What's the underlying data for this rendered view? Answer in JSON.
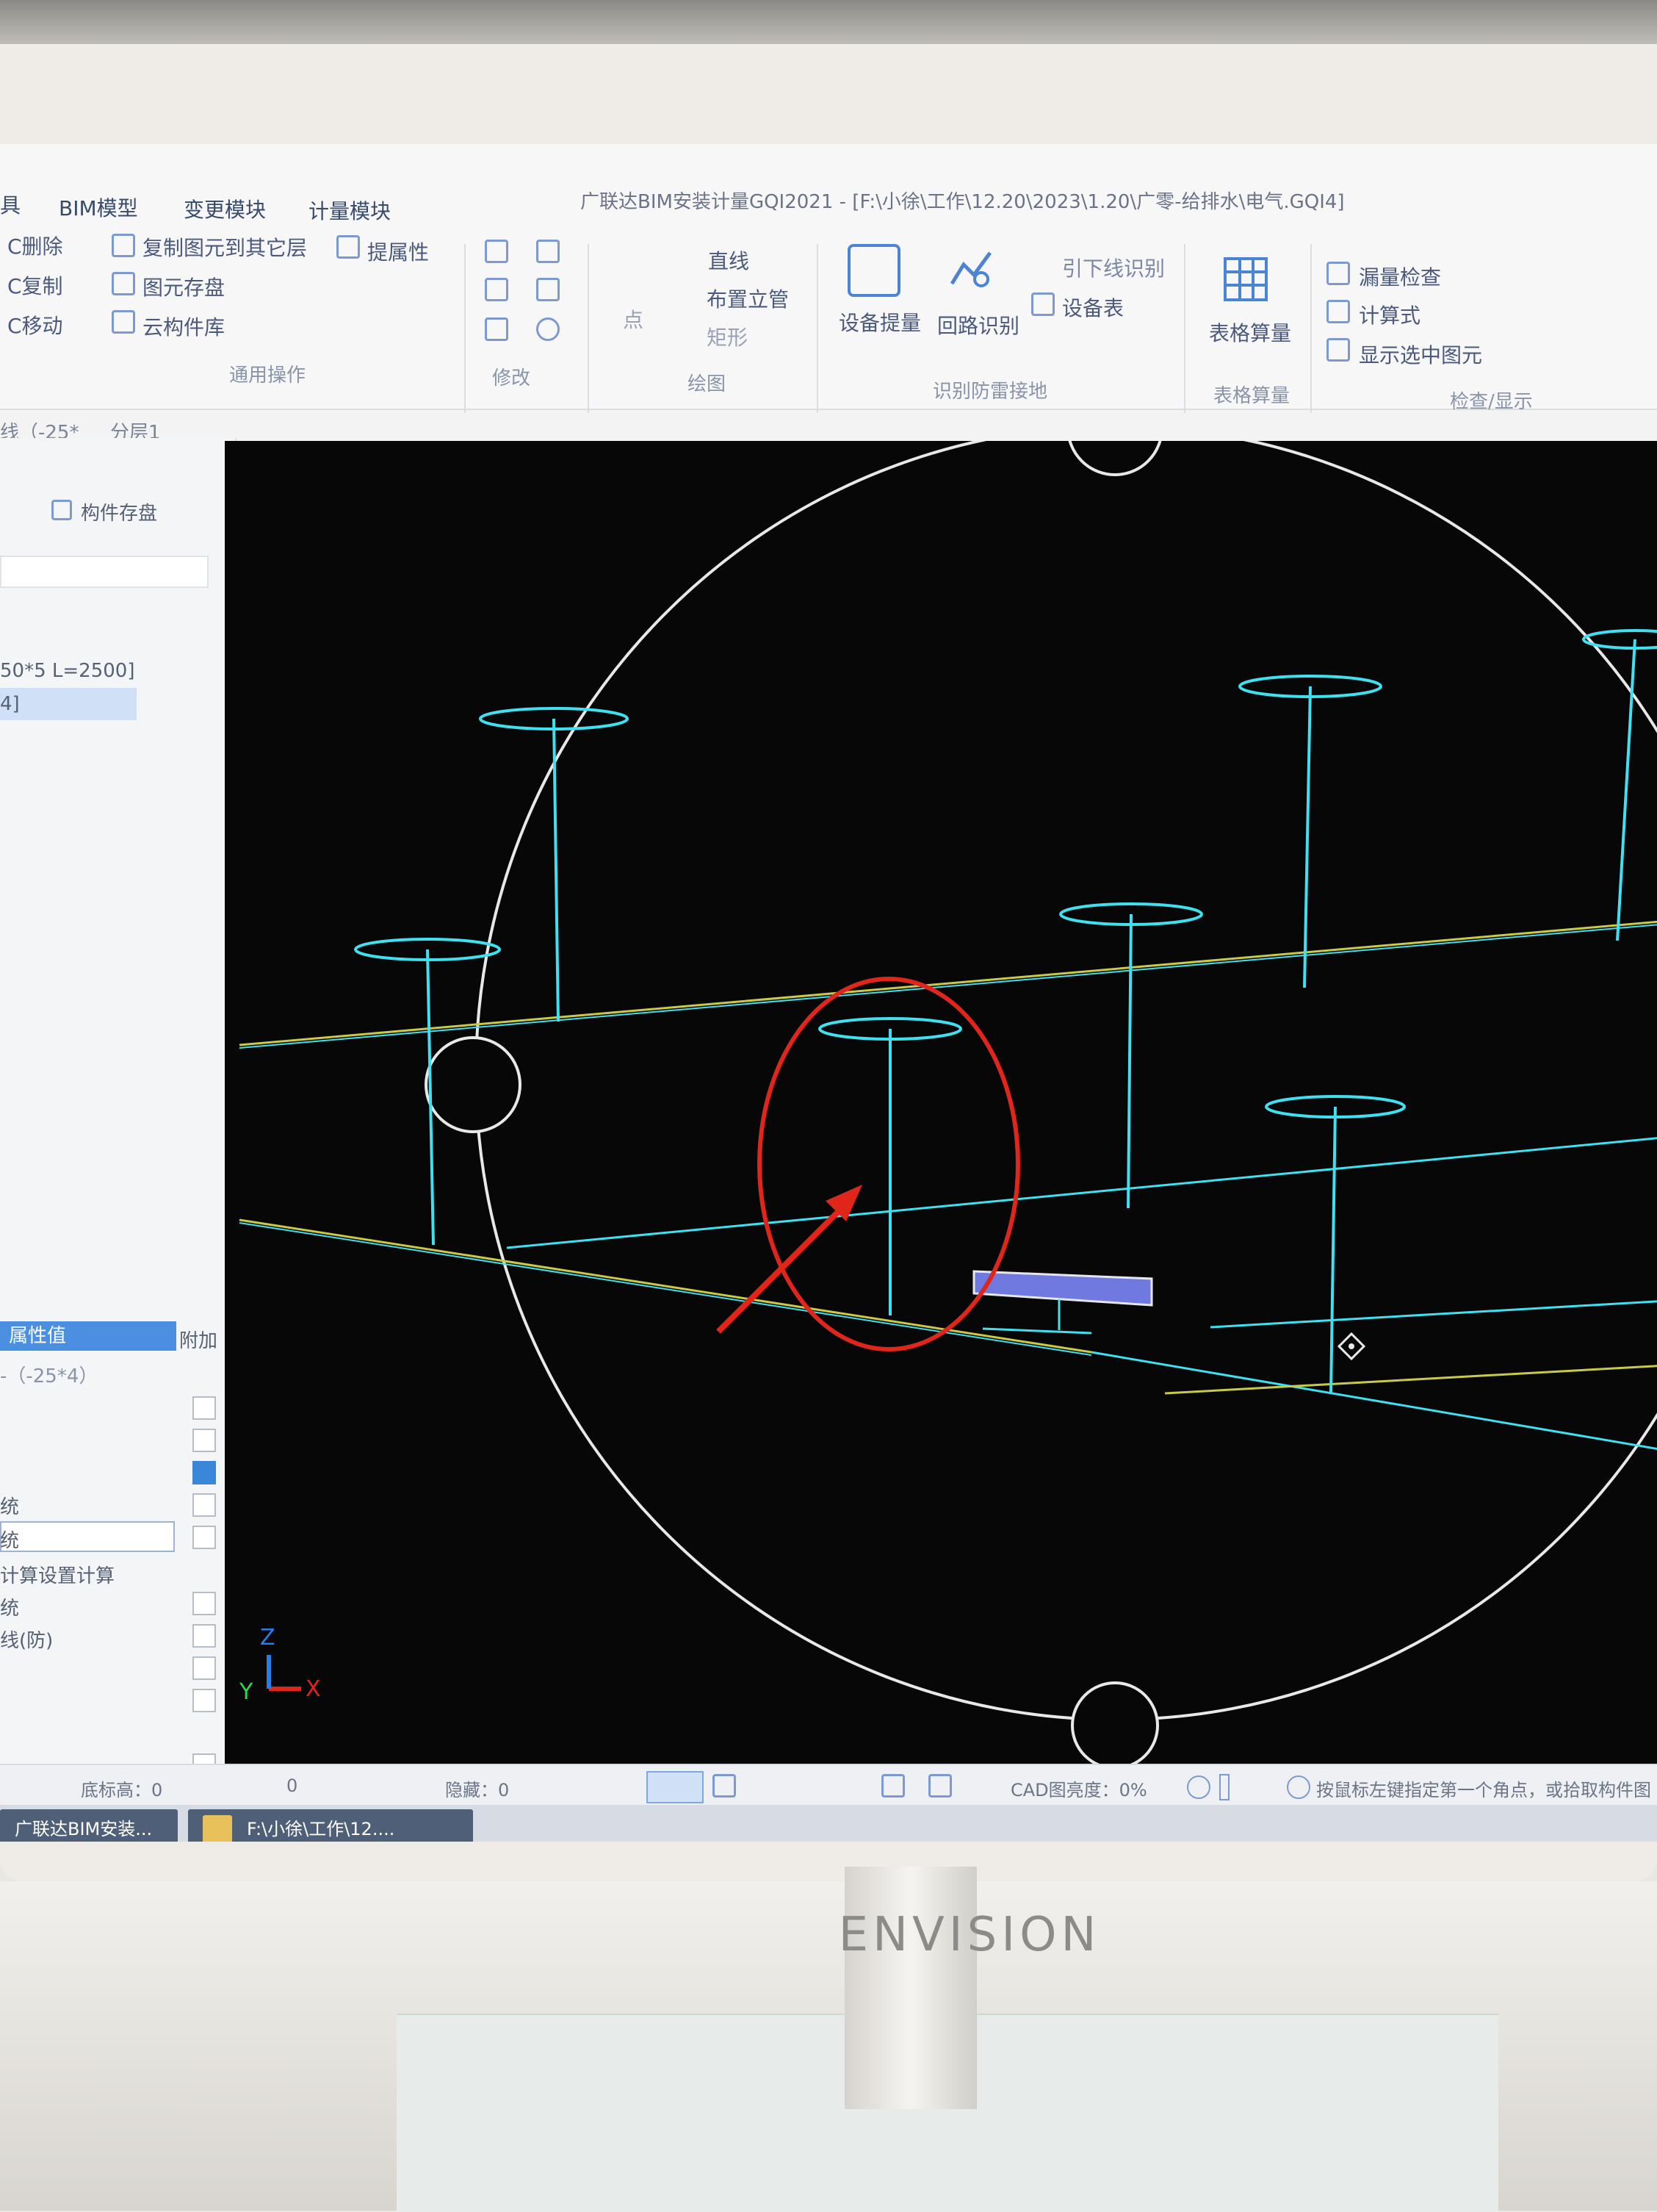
{
  "window": {
    "title": "广联达BIM安装计量GQI2021 - [F:\\小徐\\工作\\12.20\\2023\\1.20\\广零-给排水\\电气.GQI4]"
  },
  "menu": [
    "具",
    "BIM模型",
    "变更模块",
    "计量模块"
  ],
  "ribbon": {
    "common_ops": {
      "items": [
        "C删除",
        "C复制",
        "C移动",
        "复制图元到其它层",
        "图元存盘",
        "云构件库",
        "提属性"
      ],
      "label": "通用操作"
    },
    "modify": {
      "label": "修改"
    },
    "draw": {
      "items": [
        "点",
        "直线",
        "布置立管",
        "矩形"
      ],
      "label": "绘图"
    },
    "identify": {
      "items": [
        "设备提量",
        "回路识别",
        "引下线识别",
        "设备表"
      ],
      "label": "识别防雷接地"
    },
    "table": {
      "items": [
        "表格算量"
      ],
      "label": "表格算量"
    },
    "check": {
      "items": [
        "漏量检查",
        "计算式",
        "显示选中图元"
      ],
      "label": "检查/显示"
    }
  },
  "toolbar2": {
    "layer_select": "线（-25*",
    "floor_select": "分层1"
  },
  "left_panel": {
    "component_save": "构件存盘",
    "list_items": [
      "50*5 L=2500]",
      "4]"
    ],
    "tab_attr_name": "属性值",
    "tab_attr_extra": "附加",
    "attr_value": "-（-25*4）",
    "rows": [
      "统",
      "统",
      "计算设置计算",
      "统",
      "线(防)"
    ]
  },
  "viewport": {
    "axis_z": "Z",
    "axis_y": "Y",
    "axis_x": "X"
  },
  "statusbar": {
    "base_height": "底标高：0",
    "zero": "0",
    "hidden": "隐藏：0",
    "cad_brightness": "CAD图亮度：0%",
    "hint": "按鼠标左键指定第一个角点，或拾取构件图元"
  },
  "taskbar": [
    "广联达BIM安装...",
    "F:\\小徐\\工作\\12...."
  ],
  "monitor": {
    "brand": "ENVISION"
  },
  "colors": {
    "accent": "#3a86d8",
    "cyan_model": "#3fe0f0",
    "yellow_line": "#c9c94a",
    "annotation": "#e0251b"
  }
}
